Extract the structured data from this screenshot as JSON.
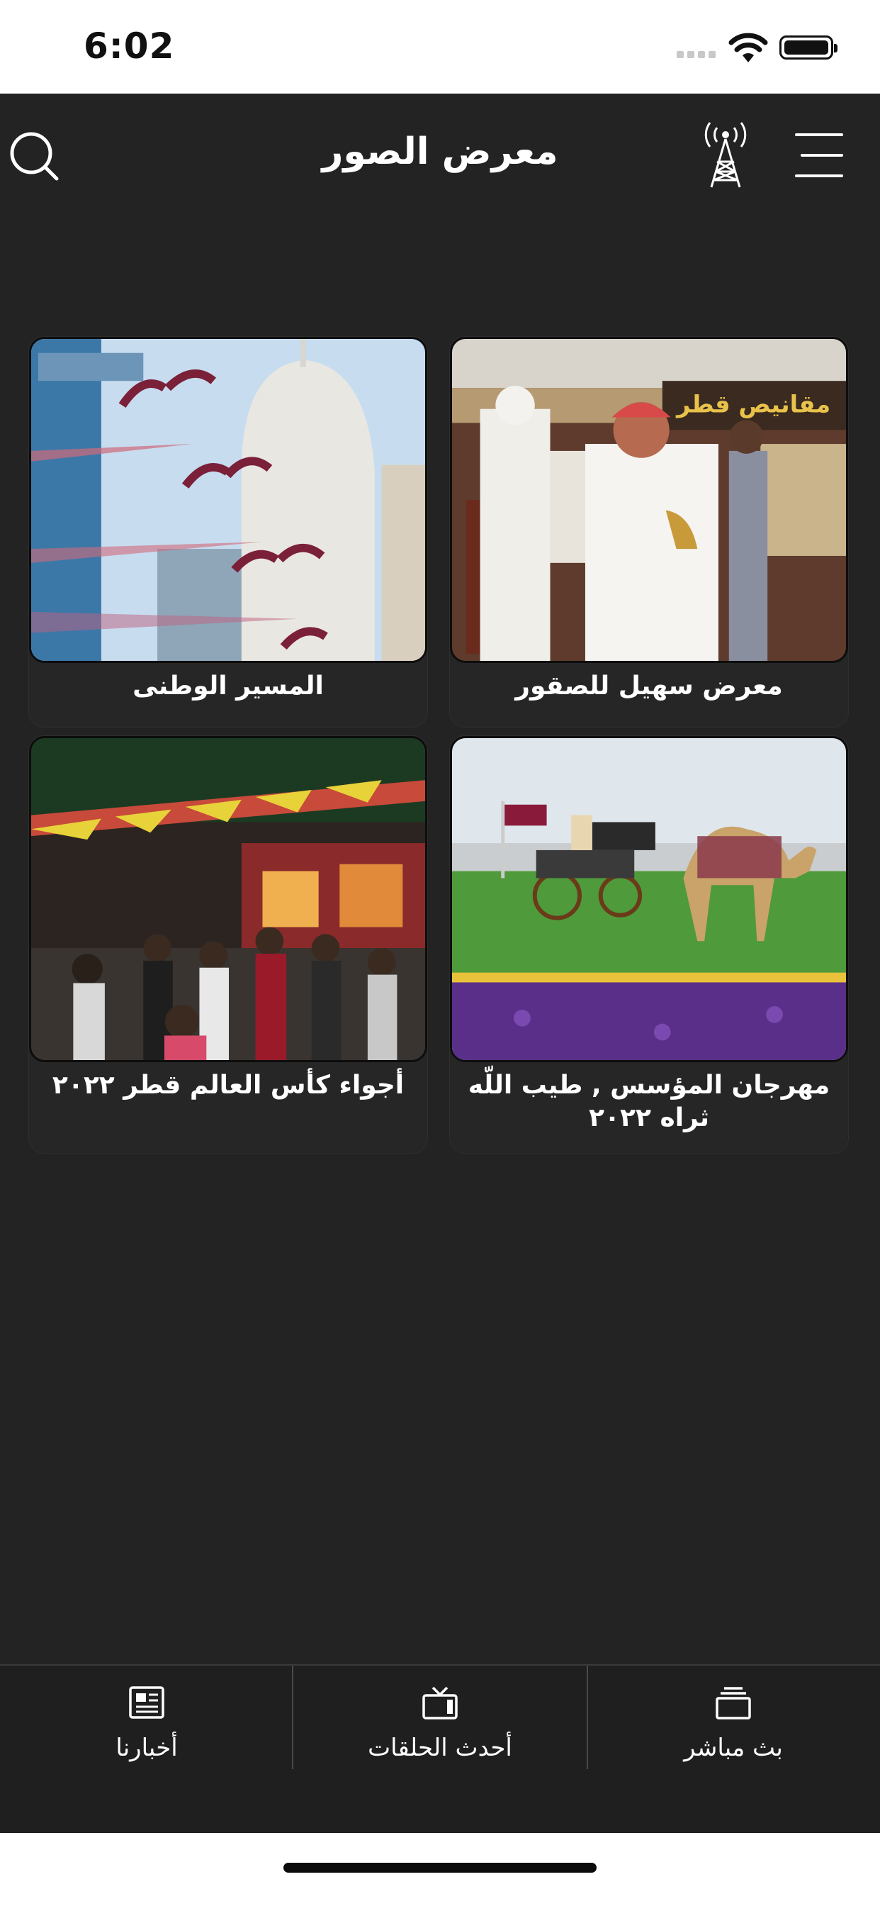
{
  "status_bar": {
    "time": "6:02"
  },
  "header": {
    "title": "معرض الصور",
    "icons": [
      "search-icon",
      "broadcast-tower-icon",
      "menu-icon"
    ]
  },
  "gallery": {
    "items": [
      {
        "label": "معرض سهيل للصقور",
        "image": "falcon exhibition photo"
      },
      {
        "label": "المسير الوطنى",
        "image": "national day parade photo"
      },
      {
        "label": "مهرجان المؤسس , طيب اللّه ثراه ٢٠٢٢",
        "image": "camel carriage festival photo"
      },
      {
        "label": "أجواء كأس العالم قطر ٢٠٢٢",
        "image": "world cup atmosphere photo"
      }
    ]
  },
  "tabbar": {
    "tabs": [
      {
        "label": "بث مباشر",
        "icon": "stack-icon"
      },
      {
        "label": "أحدث الحلقات",
        "icon": "tv-icon"
      },
      {
        "label": "أخبارنا",
        "icon": "newspaper-icon"
      }
    ]
  },
  "colors": {
    "background": "#232323",
    "tabbar": "#1f1f1f",
    "text": "#ffffff"
  }
}
